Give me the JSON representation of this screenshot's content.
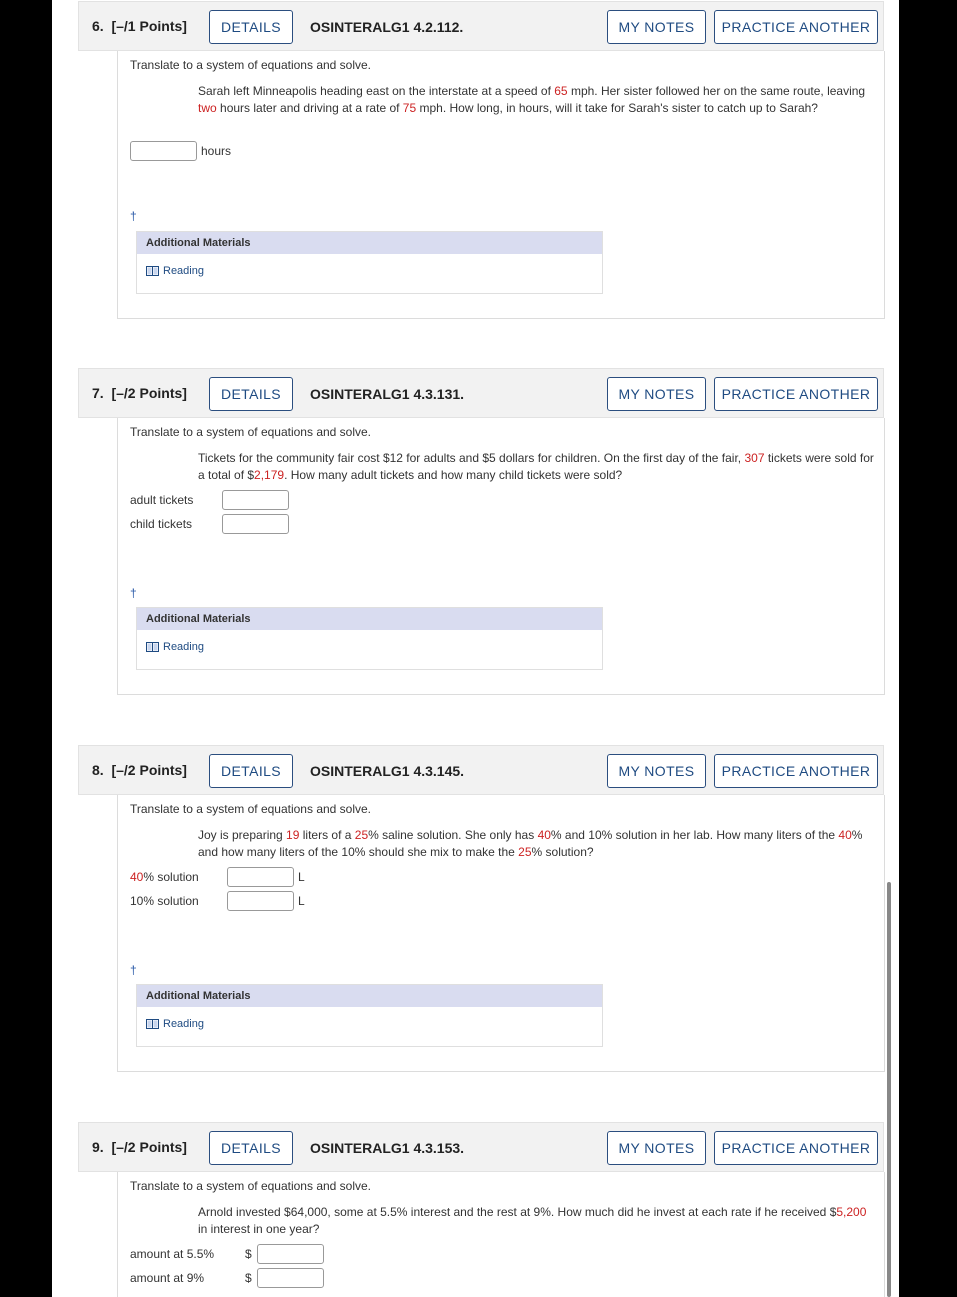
{
  "common": {
    "details_label": "DETAILS",
    "my_notes_label": "MY NOTES",
    "practice_label": "PRACTICE ANOTHER",
    "additional_materials": "Additional Materials",
    "reading_label": "Reading",
    "dagger": "†",
    "instruction": "Translate to a system of equations and solve."
  },
  "q6": {
    "number": "6.",
    "points": "[–/1 Points]",
    "id": "OSINTERALG1 4.2.112.",
    "problem": [
      {
        "t": "Sarah left Minneapolis heading east on the interstate at a speed of "
      },
      {
        "t": "65",
        "hl": true
      },
      {
        "t": " mph. Her sister followed her on the same route, leaving "
      },
      {
        "t": "two",
        "hl": true
      },
      {
        "t": " hours later and driving at a rate of "
      },
      {
        "t": "75",
        "hl": true
      },
      {
        "t": " mph. How long, in hours, will it take for Sarah's sister to catch up to Sarah?"
      }
    ],
    "unit": "hours"
  },
  "q7": {
    "number": "7.",
    "points": "[–/2 Points]",
    "id": "OSINTERALG1 4.3.131.",
    "problem": [
      {
        "t": "Tickets for the community fair cost $12 for adults and $5 dollars for children. On the first day of the fair, "
      },
      {
        "t": "307",
        "hl": true
      },
      {
        "t": " tickets were sold for a total of $"
      },
      {
        "t": "2,179",
        "hl": true
      },
      {
        "t": ". How many adult tickets and how many child tickets were sold?"
      }
    ],
    "label_adult": "adult tickets",
    "label_child": "child tickets"
  },
  "q8": {
    "number": "8.",
    "points": "[–/2 Points]",
    "id": "OSINTERALG1 4.3.145.",
    "problem": [
      {
        "t": "Joy is preparing "
      },
      {
        "t": "19",
        "hl": true
      },
      {
        "t": " liters of a "
      },
      {
        "t": "25",
        "hl": true
      },
      {
        "t": "% saline solution. She only has "
      },
      {
        "t": "40",
        "hl": true
      },
      {
        "t": "% and 10% solution in her lab. How many liters of the "
      },
      {
        "t": "40",
        "hl": true
      },
      {
        "t": "% and how many liters of the 10% should she mix to make the "
      },
      {
        "t": "25",
        "hl": true
      },
      {
        "t": "% solution?"
      }
    ],
    "label_40_num": "40",
    "label_40_rest": "% solution",
    "label_10": "10% solution",
    "unit": "L"
  },
  "q9": {
    "number": "9.",
    "points": "[–/2 Points]",
    "id": "OSINTERALG1 4.3.153.",
    "problem": [
      {
        "t": "Arnold invested $64,000, some at 5.5% interest and the rest at 9%. How much did he invest at each rate if he received $"
      },
      {
        "t": "5,200",
        "hl": true
      },
      {
        "t": " in interest in one year?"
      }
    ],
    "label_55": "amount at 5.5%",
    "label_9": "amount at 9%",
    "currency": "$"
  },
  "colors": {
    "highlight": "#cc2222",
    "link": "#1f4b82",
    "header_bg": "#f2f2f2",
    "materials_bg": "#d9dcf0"
  }
}
